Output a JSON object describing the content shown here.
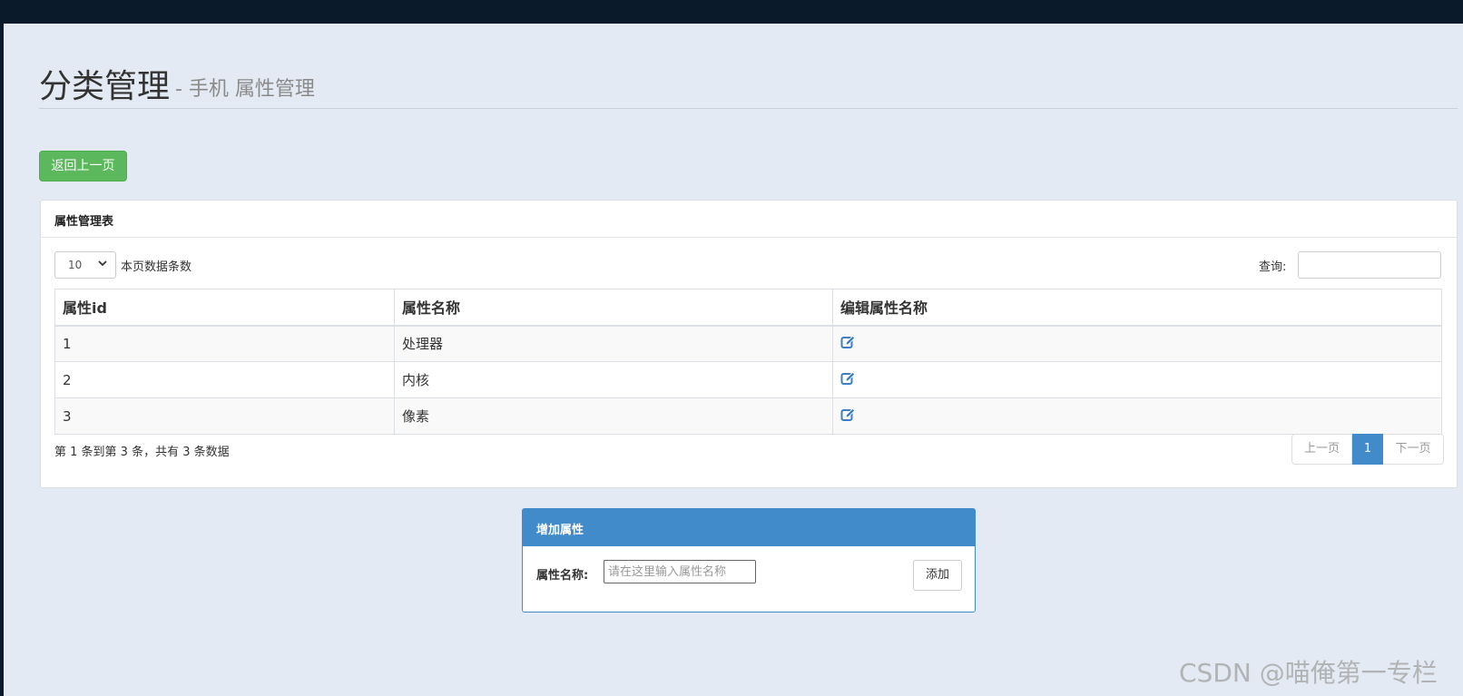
{
  "page": {
    "title": "分类管理",
    "subtitle": "- 手机 属性管理"
  },
  "actions": {
    "back_label": "返回上一页"
  },
  "table_panel": {
    "heading": "属性管理表",
    "length_value": "10",
    "length_label": "本页数据条数",
    "search_label": "查询:",
    "search_value": "",
    "columns": [
      "属性id",
      "属性名称",
      "编辑属性名称"
    ],
    "rows": [
      {
        "id": "1",
        "name": "处理器"
      },
      {
        "id": "2",
        "name": "内核"
      },
      {
        "id": "3",
        "name": "像素"
      }
    ],
    "info": "第 1 条到第 3 条，共有 3 条数据",
    "pagination": {
      "prev": "上一页",
      "current": "1",
      "next": "下一页"
    }
  },
  "add_panel": {
    "heading": "增加属性",
    "field_label": "属性名称:",
    "field_placeholder": "请在这里输入属性名称",
    "field_value": "",
    "submit_label": "添加"
  },
  "watermark": "CSDN @喵俺第一专栏",
  "icons": {
    "edit": "edit-icon",
    "select_chevron": "chevron-down-icon"
  },
  "colors": {
    "primary": "#428bca",
    "success": "#5cb85c",
    "page_bg": "#e3eaf3",
    "topbar": "#0b1a2b"
  }
}
